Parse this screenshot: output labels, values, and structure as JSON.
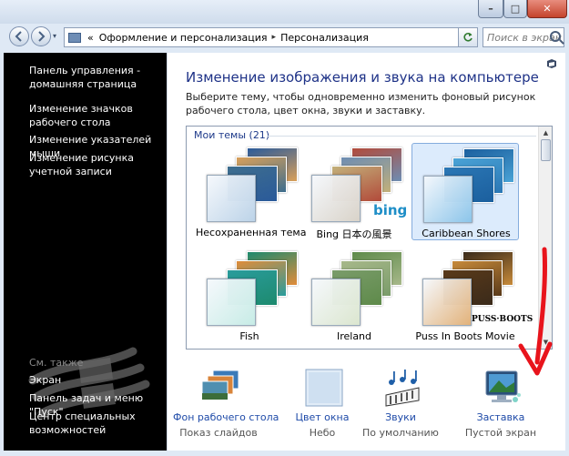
{
  "window": {
    "minimize_glyph": "–",
    "maximize_glyph": "□",
    "close_glyph": "✕"
  },
  "address_bar": {
    "chevron": "«",
    "segments": [
      "Оформление и персонализация",
      "Персонализация"
    ],
    "separator": "▸",
    "dropdown_glyph": "▾",
    "search_placeholder": "Поиск в экран"
  },
  "sidebar": {
    "home_link": "Панель управления - домашняя страница",
    "links": [
      "Изменение значков рабочего стола",
      "Изменение указателей мыши",
      "Изменение рисунка учетной записи"
    ],
    "see_also_title": "См. также",
    "see_also_links": [
      "Экран",
      "Панель задач и меню \"Пуск\"",
      "Центр специальных возможностей"
    ]
  },
  "main": {
    "title": "Изменение изображения и звука на компьютере",
    "description": "Выберите тему, чтобы одновременно изменить фоновый рисунок рабочего стола, цвет окна, звуки и заставку.",
    "group_label": "Мои темы (21)",
    "themes": [
      {
        "label": "Несохраненная тема",
        "selected": false,
        "colors": [
          "#2a5a9a",
          "#d9a05a",
          "#3e6e8e"
        ],
        "glass": "#bcd3e8"
      },
      {
        "label": "Bing 日本の風景",
        "selected": false,
        "colors": [
          "#b24a3a",
          "#6d8db3",
          "#c2b07a"
        ],
        "glass": "#d9d3c9",
        "badge": "bing"
      },
      {
        "label": "Caribbean Shores",
        "selected": true,
        "colors": [
          "#1b5f9e",
          "#4aa3d6",
          "#2b77b5"
        ],
        "glass": "#8cc5ea"
      },
      {
        "label": "Fish",
        "selected": false,
        "colors": [
          "#1d8a6e",
          "#e08c3a",
          "#2a9c9c"
        ],
        "glass": "#c7ece6"
      },
      {
        "label": "Ireland",
        "selected": false,
        "colors": [
          "#5e8a4a",
          "#a7b88a",
          "#7a9c6a"
        ],
        "glass": "#dbe6cf"
      },
      {
        "label": "Puss In Boots Movie",
        "selected": false,
        "colors": [
          "#3a2a1a",
          "#c78a3a",
          "#5a3a1a"
        ],
        "glass": "#e2b27a",
        "badge": "PUSS·BOOTS"
      }
    ]
  },
  "bottom": [
    {
      "label": "Фон рабочего стола",
      "sub": "Показ слайдов",
      "icon": "desktop-background-icon"
    },
    {
      "label": "Цвет окна",
      "sub": "Небо",
      "icon": "window-color-icon"
    },
    {
      "label": "Звуки",
      "sub": "По умолчанию",
      "icon": "sounds-icon"
    },
    {
      "label": "Заставка",
      "sub": "Пустой экран",
      "icon": "screensaver-icon"
    }
  ],
  "colors": {
    "link": "#1e4aa8",
    "title": "#1e3287",
    "annotation": "#e8141c"
  }
}
